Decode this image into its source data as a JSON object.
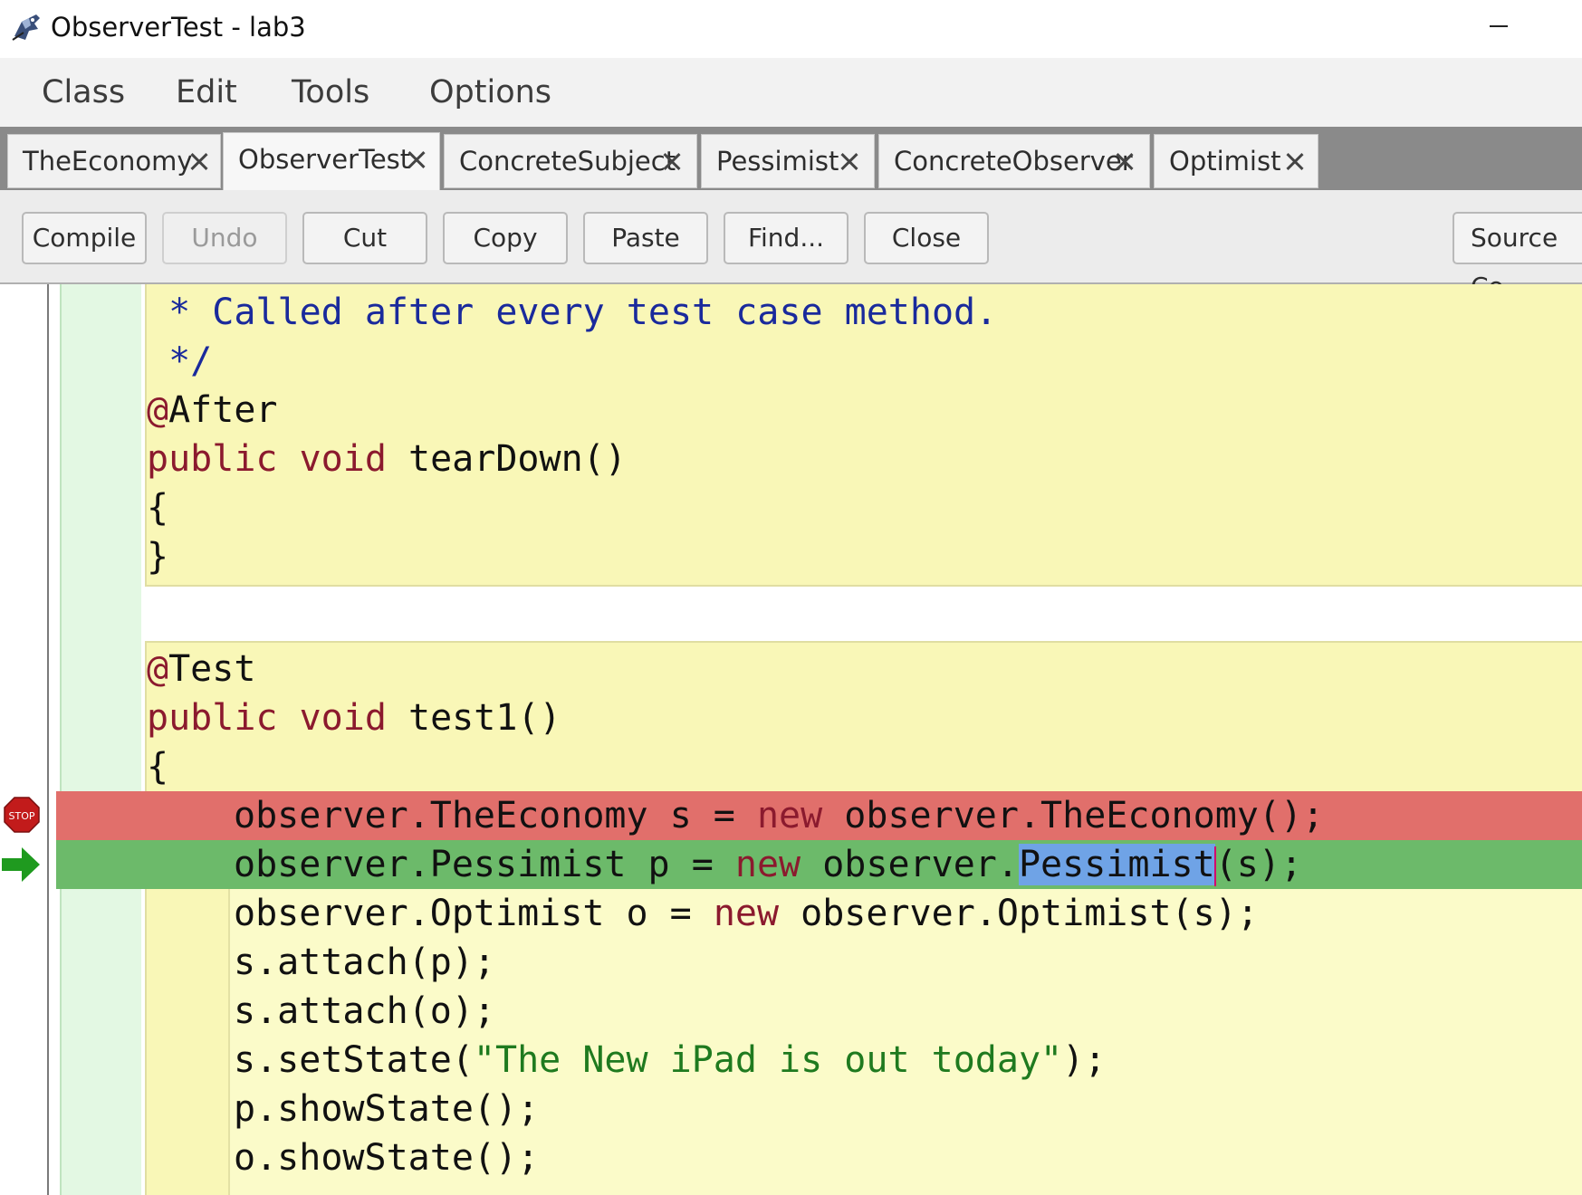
{
  "window": {
    "title": "ObserverTest - lab3"
  },
  "menu": {
    "items": [
      "Class",
      "Edit",
      "Tools",
      "Options"
    ]
  },
  "tabs": [
    {
      "label": "TheEconomy",
      "active": false
    },
    {
      "label": "ObserverTest",
      "active": true
    },
    {
      "label": "ConcreteSubject",
      "active": false
    },
    {
      "label": "Pessimist",
      "active": false
    },
    {
      "label": "ConcreteObserver",
      "active": false
    },
    {
      "label": "Optimist",
      "active": false
    }
  ],
  "toolbar": {
    "compile": "Compile",
    "undo": "Undo",
    "cut": "Cut",
    "copy": "Copy",
    "paste": "Paste",
    "find": "Find...",
    "close": "Close",
    "view_mode": "Source Co"
  },
  "editor": {
    "lines": {
      "l1": " * Called after every test case method.",
      "l2": " */",
      "l3_kw": "@",
      "l3": "After",
      "l4_kw1": "public",
      "l4_kw2": "void",
      "l4": "tearDown()",
      "l5": "{",
      "l6": "}",
      "l7_kw": "@",
      "l7": "Test",
      "l8_kw1": "public",
      "l8_kw2": "void",
      "l8": "test1()",
      "l9": "{",
      "l10_a": "observer.TheEconomy s = ",
      "l10_kw": "new",
      "l10_b": " observer.TheEconomy();",
      "l11_a": "observer.Pessimist p = ",
      "l11_kw": "new",
      "l11_b": " observer.",
      "l11_sel": "Pessimist",
      "l11_c": "(s);",
      "l12_a": "observer.Optimist o = ",
      "l12_kw": "new",
      "l12_b": " observer.Optimist(s);",
      "l13": "s.attach(p);",
      "l14": "s.attach(o);",
      "l15_a": "s.setState(",
      "l15_str": "\"The New iPad is out today\"",
      "l15_b": ");",
      "l16": "p.showState();",
      "l17": "o.showState();"
    },
    "breakpoint_label": "STOP",
    "colors": {
      "breakpoint_line": "#e16f6b",
      "execution_line": "#6cba6a",
      "scope_method": "#f9f7b7",
      "scope_class": "#e3f8e3",
      "keyword": "#8b1a2e",
      "string": "#1f7a1f",
      "comment": "#1a2a9c",
      "selection": "#6fa3e6"
    }
  }
}
